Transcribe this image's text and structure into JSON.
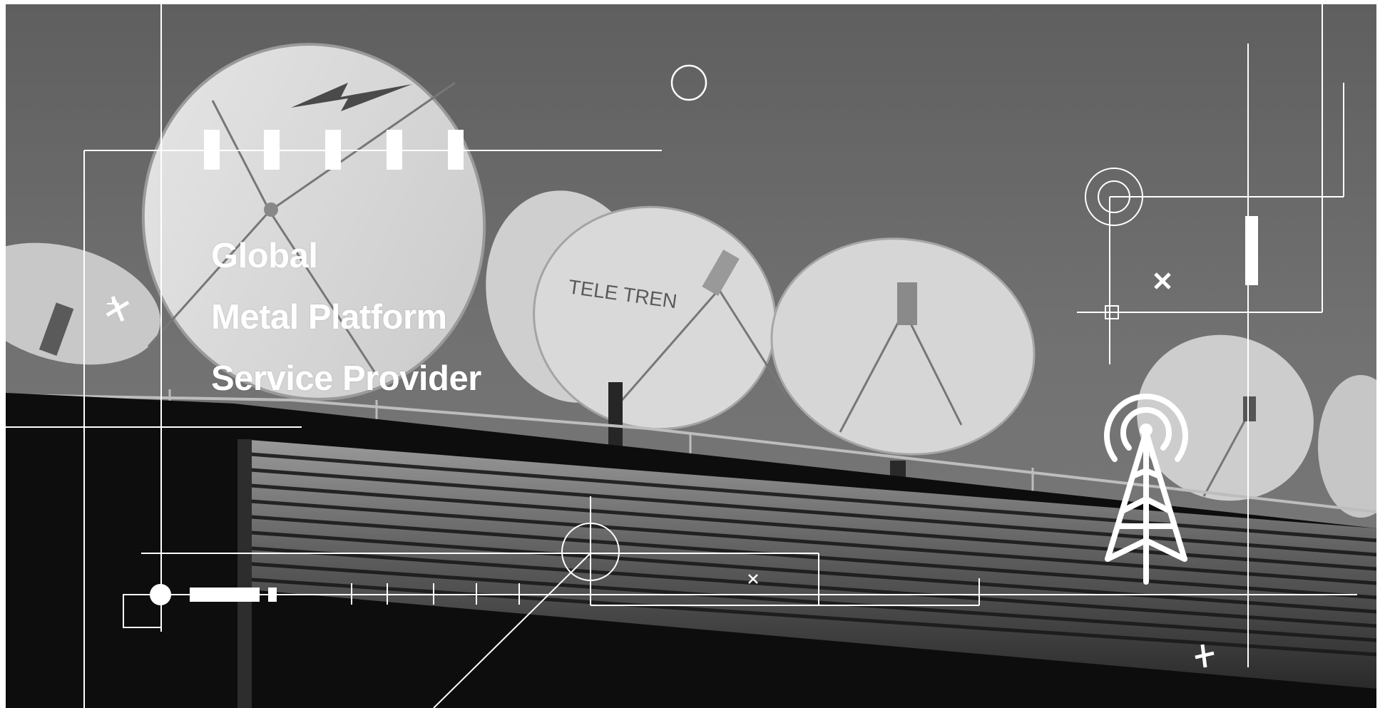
{
  "hero": {
    "headline": {
      "line1": "Global",
      "line2": "Metal Platform",
      "line3": "Service Provider"
    },
    "dish_label": "TELE TREN"
  },
  "colors": {
    "sky": "#6e6e6e",
    "dish": "#d9d9d9",
    "building_dark": "#0c0c0c",
    "overlay_lines": "#ffffff"
  },
  "icons": [
    "radio-tower-icon",
    "lightning-bolt-icon",
    "plus-icon",
    "close-icon",
    "target-icon",
    "circle-icon"
  ]
}
